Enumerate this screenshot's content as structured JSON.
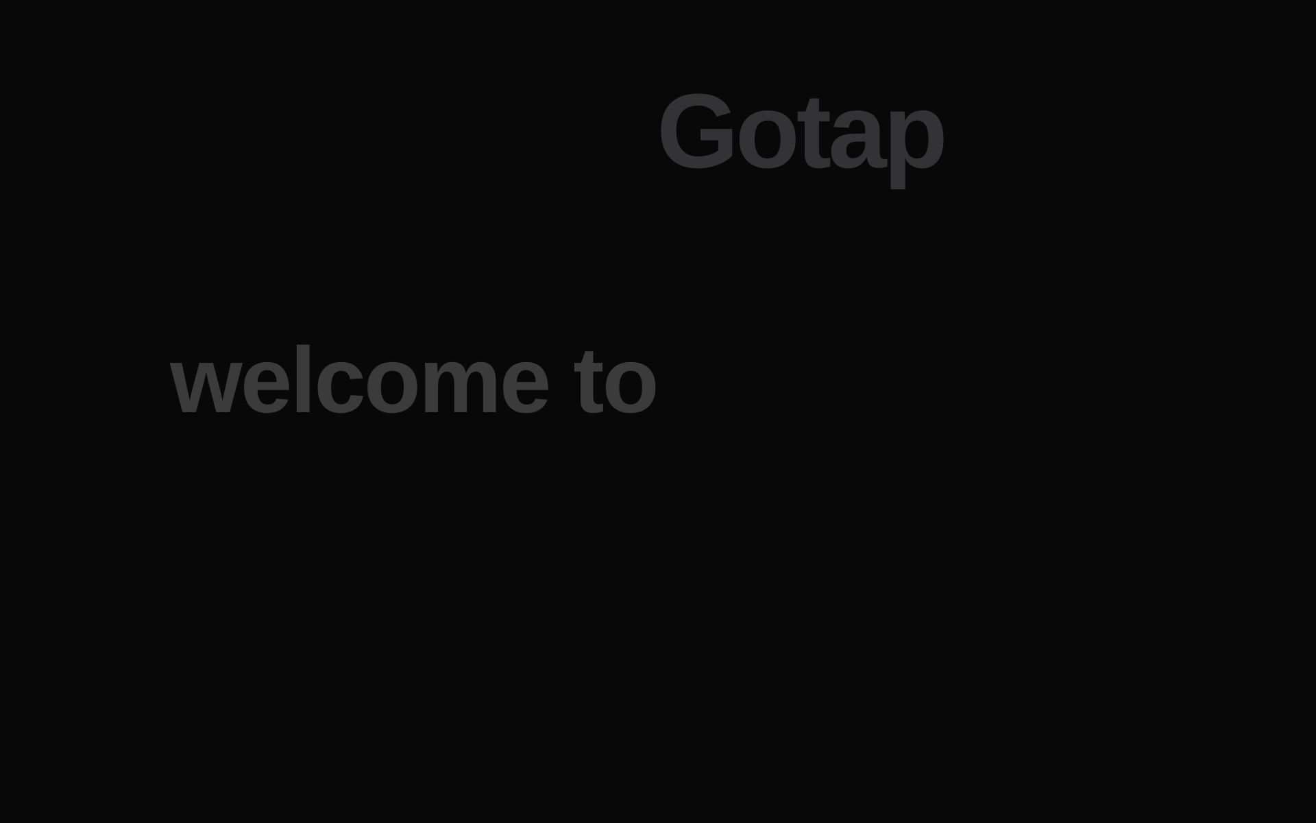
{
  "brand": {
    "name": "Gotap"
  },
  "welcome": {
    "text": "welcome to"
  },
  "colors": {
    "background": "#080808",
    "brand_text": "#333336",
    "welcome_text": "#3b3b3b"
  }
}
